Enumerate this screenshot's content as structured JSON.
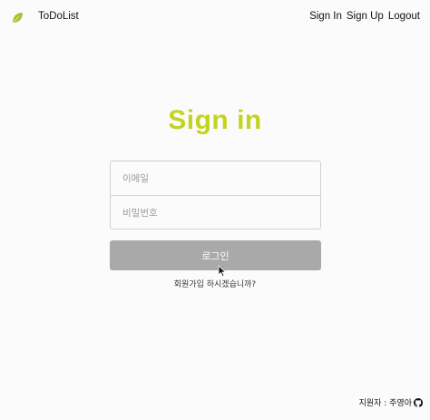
{
  "header": {
    "brand": "ToDoList",
    "nav": {
      "sign_in": "Sign In",
      "sign_up": "Sign Up",
      "logout": "Logout"
    },
    "logo_icon": "leaf-icon"
  },
  "main": {
    "title": "Sign in",
    "email": {
      "placeholder": "이메일",
      "value": ""
    },
    "password": {
      "placeholder": "비밀번호",
      "value": ""
    },
    "login_button": "로그인",
    "signup_prompt": "회원가입 하시겠습니까?"
  },
  "footer": {
    "credit": "지원자 : 주영아",
    "icon": "github-icon"
  },
  "colors": {
    "accent": "#c3d41c",
    "button_disabled": "#a9a9a9"
  }
}
